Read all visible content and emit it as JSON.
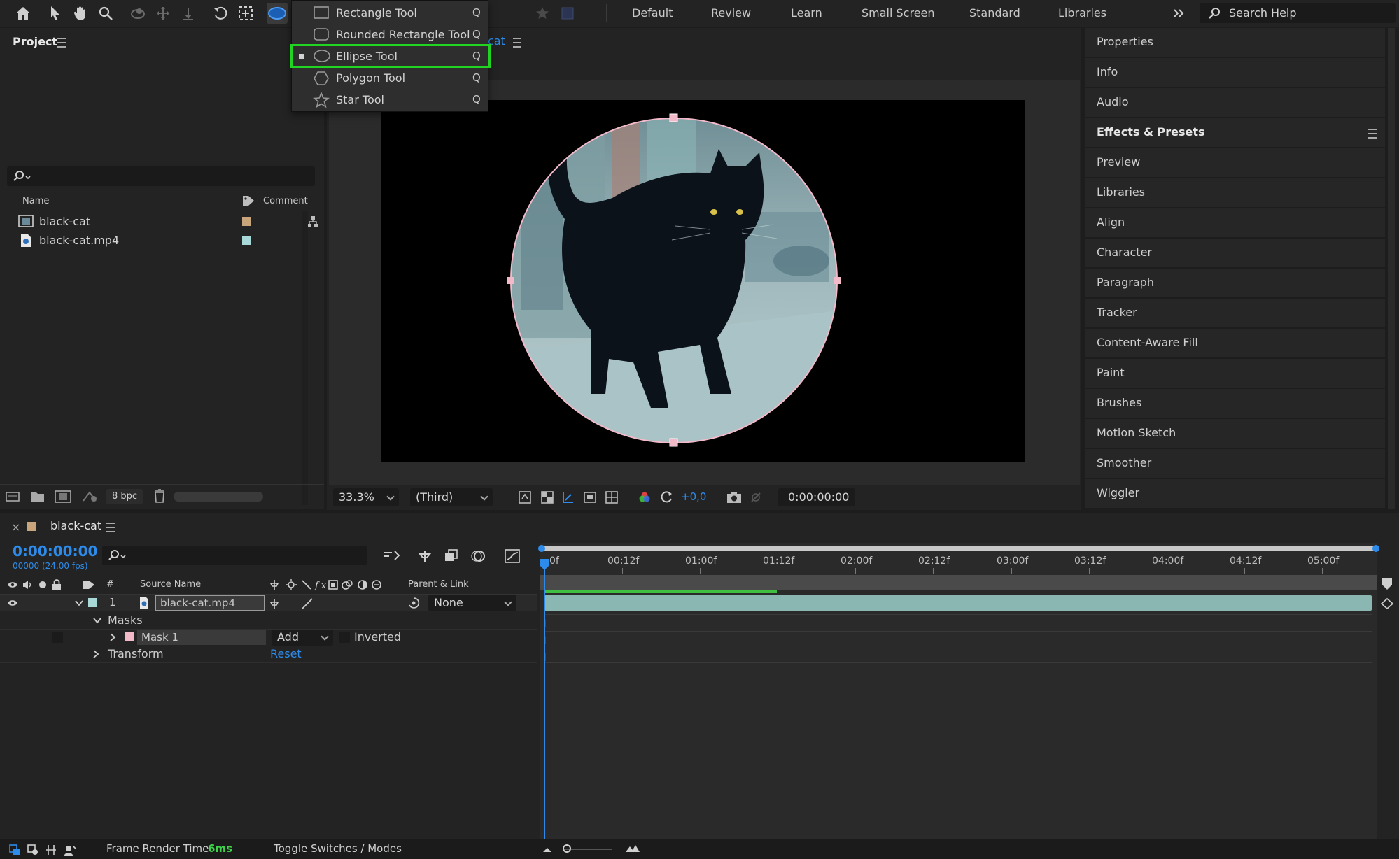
{
  "toolbar": {
    "workspaces": [
      "Default",
      "Review",
      "Learn",
      "Small Screen",
      "Standard",
      "Libraries"
    ],
    "search_placeholder": "Search Help"
  },
  "shape_menu": {
    "items": [
      {
        "label": "Rectangle Tool",
        "shortcut": "Q",
        "icon": "rectangle-icon"
      },
      {
        "label": "Rounded Rectangle Tool",
        "shortcut": "Q",
        "icon": "rounded-rectangle-icon"
      },
      {
        "label": "Ellipse Tool",
        "shortcut": "Q",
        "icon": "ellipse-icon",
        "selected": true
      },
      {
        "label": "Polygon Tool",
        "shortcut": "Q",
        "icon": "polygon-icon"
      },
      {
        "label": "Star Tool",
        "shortcut": "Q",
        "icon": "star-icon"
      }
    ]
  },
  "project": {
    "title": "Project",
    "columns": {
      "name": "Name",
      "comment": "Comment"
    },
    "items": [
      {
        "name": "black-cat",
        "type": "composition",
        "label_color": "#c9a57b"
      },
      {
        "name": "black-cat.mp4",
        "type": "footage",
        "label_color": "#a8d8d8"
      }
    ],
    "bit_depth": "8 bpc"
  },
  "viewer": {
    "tab_fragment": "cat",
    "zoom": "33.3%",
    "view": "(Third)",
    "exposure": "+0,0",
    "timecode": "0:00:00:00"
  },
  "right_panels": {
    "items": [
      "Properties",
      "Info",
      "Audio",
      "Effects & Presets",
      "Preview",
      "Libraries",
      "Align",
      "Character",
      "Paragraph",
      "Tracker",
      "Content-Aware Fill",
      "Paint",
      "Brushes",
      "Motion Sketch",
      "Smoother",
      "Wiggler"
    ]
  },
  "timeline": {
    "comp_name": "black-cat",
    "timecode": "0:00:00:00",
    "frames": "00000 (24.00 fps)",
    "columns": {
      "number": "#",
      "source": "Source Name",
      "parent": "Parent & Link"
    },
    "layer": {
      "number": "1",
      "name": "black-cat.mp4",
      "parent": "None"
    },
    "masks_label": "Masks",
    "mask": {
      "name": "Mask 1",
      "mode": "Add",
      "inverted": "Inverted"
    },
    "transform_label": "Transform",
    "reset_label": "Reset",
    "ruler": [
      "0f",
      "00:12f",
      "01:00f",
      "01:12f",
      "02:00f",
      "02:12f",
      "03:00f",
      "03:12f",
      "04:00f",
      "04:12f",
      "05:00f"
    ]
  },
  "status": {
    "render_label": "Frame Render Time",
    "render_value": "6ms",
    "toggle_label": "Toggle Switches / Modes"
  },
  "colors": {
    "accent_blue": "#2d8ceb",
    "highlight_green": "#22d422",
    "layer_bar": "#8ab7b2",
    "mask_color": "#f2b9c9"
  }
}
